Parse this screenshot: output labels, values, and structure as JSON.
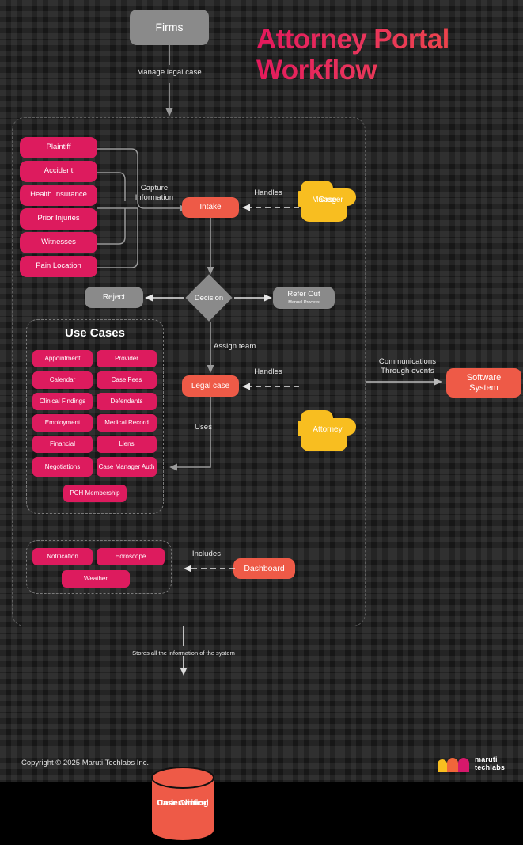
{
  "header": {
    "title_line1": "Attorney Portal",
    "title_line2": "Workflow",
    "gradient_from": "#E4175C",
    "gradient_to": "#F0503F"
  },
  "nodes": {
    "firms": "Firms",
    "intake": "Intake",
    "case_manager": "Case\nManager",
    "case_manager_l1": "Case",
    "case_manager_l2": "Manager",
    "decision": "Decision",
    "reject": "Reject",
    "refer_out": "Refer Out",
    "refer_out_sub": "Manual Process",
    "legal_case": "Legal case",
    "attorney": "Attorney",
    "software_system_l1": "Software",
    "software_system_l2": "System",
    "dashboard": "Dashboard",
    "database_l1": "Case Clinical",
    "database_l2": "Underwriting"
  },
  "edges": {
    "manage_legal_case": "Manage legal case",
    "capture_information_l1": "Capture",
    "capture_information_l2": "Information",
    "handles_intake": "Handles",
    "handles_legal": "Handles",
    "assign_team": "Assign team",
    "uses": "Uses",
    "includes": "Includes",
    "communications_l1": "Communications",
    "communications_l2": "Through events",
    "stores": "Stores all the information of the system"
  },
  "intake_inputs": [
    "Plaintiff",
    "Accident",
    "Health Insurance",
    "Prior Injuries",
    "Witnesses",
    "Pain Location"
  ],
  "use_cases_panel": {
    "title": "Use Cases",
    "items": [
      "Appointment",
      "Provider",
      "Calendar",
      "Case Fees",
      "Clinical Findings",
      "Defendants",
      "Employment",
      "Medical Record",
      "Financial",
      "Liens",
      "Negotiations",
      "Case Manager\nAuth",
      "PCH Membership"
    ],
    "left_column": [
      "Appointment",
      "Calendar",
      "Clinical Findings",
      "Employment",
      "Financial",
      "Negotiations"
    ],
    "right_column": [
      "Provider",
      "Case Fees",
      "Defendants",
      "Medical Record",
      "Liens",
      "Case Manager Auth"
    ],
    "full_width": [
      "PCH Membership"
    ]
  },
  "dashboard_panel": {
    "left_column": [
      "Notification"
    ],
    "right_column": [
      "Horoscope"
    ],
    "full_width": [
      "Weather"
    ]
  },
  "footer": {
    "copyright": "Copyright © 2025 Maruti Techlabs Inc.",
    "logo_line1": "maruti",
    "logo_line2": "techlabs"
  },
  "colors": {
    "pink": "#DD1B5E",
    "salmon": "#EE5A47",
    "amber": "#F8BE20",
    "gray": "#8a8a8a",
    "background": "#0a0a0a"
  }
}
